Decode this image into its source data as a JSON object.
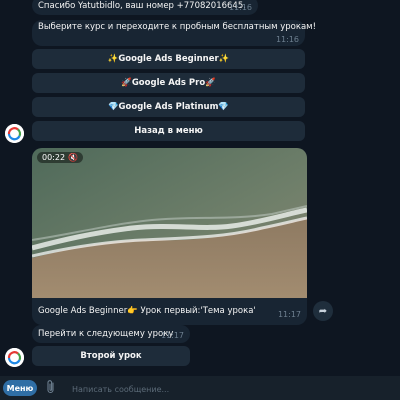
{
  "messages": {
    "m1": {
      "text": "Спасибо Yatutbidlo, ваш номер +77082016645.",
      "time": "11:16"
    },
    "m2": {
      "text": "Выберите курс и переходите к пробным бесплатным урокам!",
      "time": "11:16"
    },
    "video": {
      "duration": "00:22",
      "caption": "Google Ads Beginner👉 Урок первый:'Тема урока'",
      "time": "11:17"
    },
    "m3": {
      "text": "Перейти к следующему уроку",
      "time": "11:17"
    }
  },
  "keyboard1": [
    "✨Google Ads Beginner✨",
    "🚀Google Ads Pro🚀",
    "💎Google Ads Platinum💎",
    "Назад в меню"
  ],
  "keyboard2": [
    "Второй урок"
  ],
  "bottom": {
    "menu_label": "Меню",
    "placeholder": "Написать сообщение..."
  },
  "colors": {
    "background": "#0e1621",
    "bubble": "#182533",
    "button": "#1e2c3a",
    "menu_button": "#2f6ea5"
  },
  "icons": [
    "bot-avatar-icon",
    "mute-icon",
    "share-icon",
    "paperclip-icon"
  ]
}
